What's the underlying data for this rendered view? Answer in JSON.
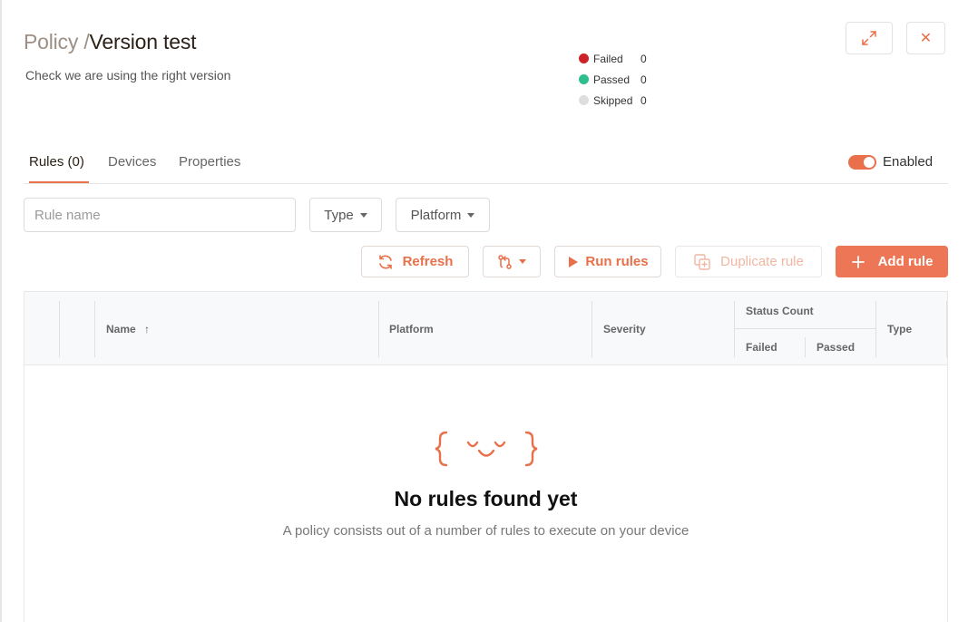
{
  "header": {
    "breadcrumb": "Policy /",
    "title": "Version test",
    "description": "Check we are using the right version"
  },
  "status_legend": [
    {
      "label": "Failed",
      "count": "0",
      "color": "#cc2228"
    },
    {
      "label": "Passed",
      "count": "0",
      "color": "#2fbf8f"
    },
    {
      "label": "Skipped",
      "count": "0",
      "color": "#dedede"
    }
  ],
  "window_controls": {
    "expand_icon": "expand-icon",
    "close_icon": "close-icon",
    "close_glyph": "✕"
  },
  "tabs": [
    {
      "label": "Rules (0)",
      "active": true
    },
    {
      "label": "Devices",
      "active": false
    },
    {
      "label": "Properties",
      "active": false
    }
  ],
  "enabled_toggle": {
    "label": "Enabled",
    "on": true
  },
  "filters": {
    "rule_name_placeholder": "Rule name",
    "type_label": "Type",
    "platform_label": "Platform"
  },
  "toolbar": {
    "refresh_label": "Refresh",
    "run_label": "Run rules",
    "duplicate_label": "Duplicate rule",
    "add_label": "Add rule"
  },
  "table": {
    "columns": {
      "name": "Name",
      "name_sort": "↑",
      "platform": "Platform",
      "severity": "Severity",
      "status_count": "Status Count",
      "failed": "Failed",
      "passed": "Passed",
      "type": "Type"
    }
  },
  "empty_state": {
    "face_icon": "empty-face-icon",
    "title": "No rules found yet",
    "subtitle": "A policy consists out of a number of rules to execute on your device"
  },
  "colors": {
    "accent": "#e8704a",
    "accent_button": "#ec7656",
    "failed": "#cc2228",
    "passed": "#2fbf8f",
    "skipped": "#dedede"
  }
}
